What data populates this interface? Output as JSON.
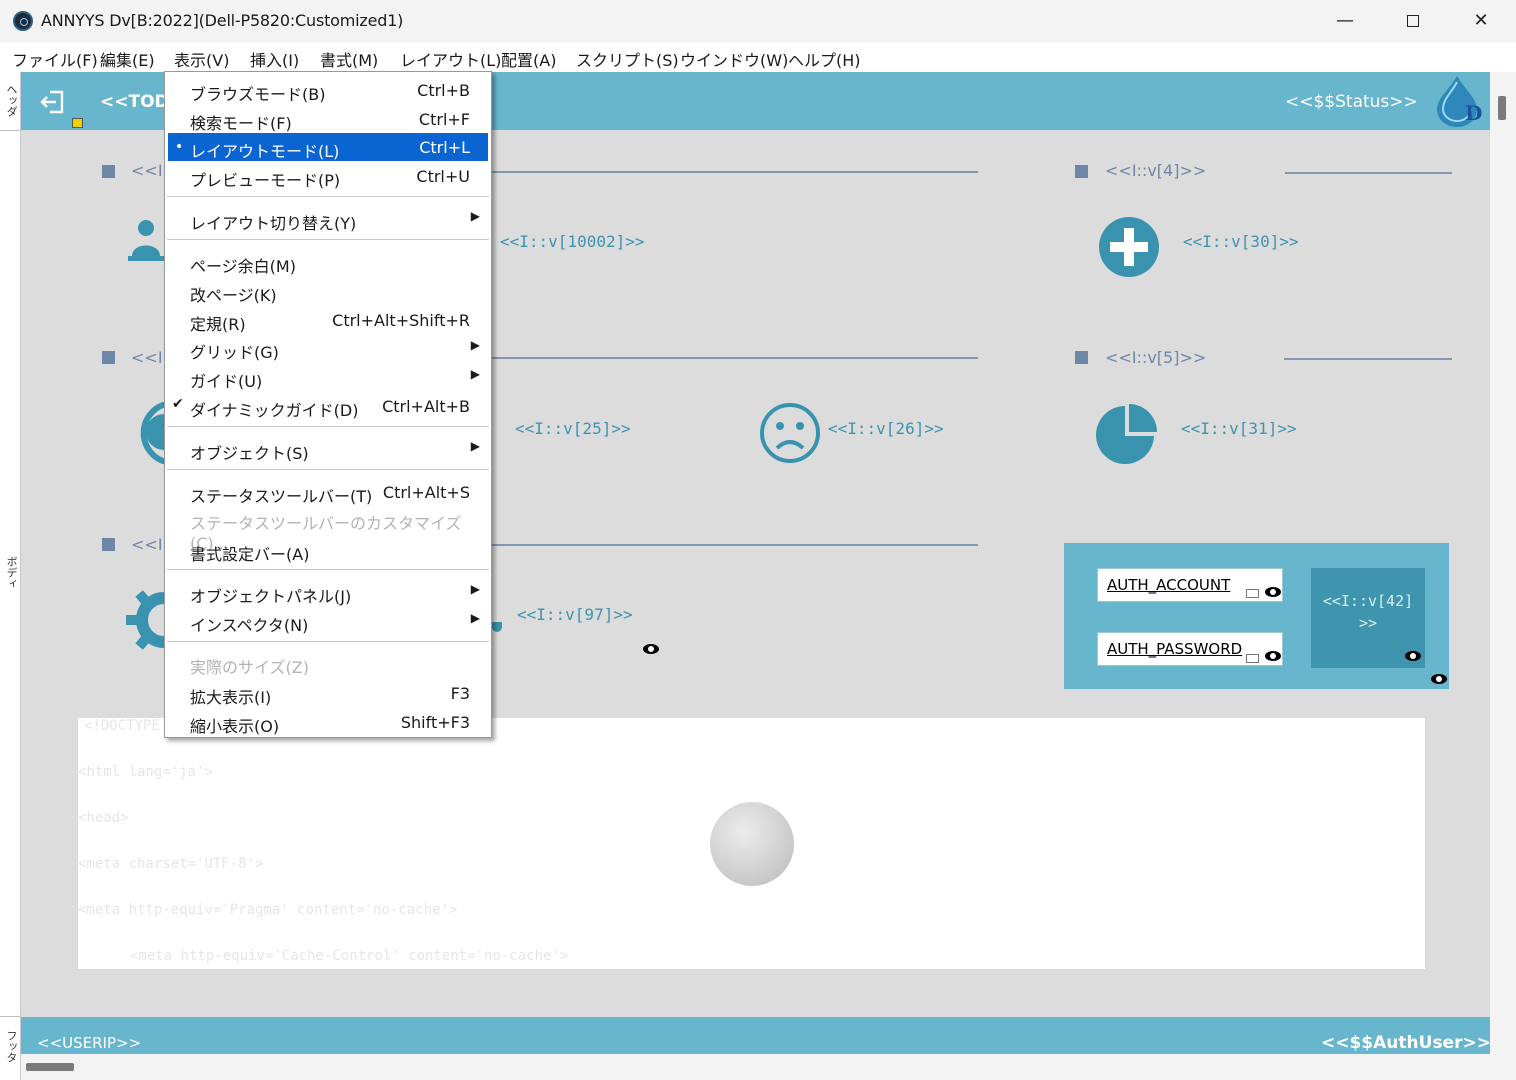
{
  "window": {
    "title": "ANNYYS Dv[B:2022](Dell-P5820:Customized1)"
  },
  "menubar": [
    {
      "label": "ファイル(F)"
    },
    {
      "label": "編集(E)"
    },
    {
      "label": "表示(V)"
    },
    {
      "label": "挿入(I)"
    },
    {
      "label": "書式(M)"
    },
    {
      "label": "レイアウト(L)"
    },
    {
      "label": "配置(A)"
    },
    {
      "label": "スクリプト(S)"
    },
    {
      "label": "ウインドウ(W)"
    },
    {
      "label": "ヘルプ(H)"
    }
  ],
  "ruler": {
    "header": "ヘッダ",
    "body": "ボディ",
    "footer": "フッタ"
  },
  "header": {
    "today": "<<TODA",
    "status": "<<$$Status>>"
  },
  "footer": {
    "userip": "<<USERIP>>",
    "authuser": "<<$$AuthUser>>"
  },
  "layout": {
    "row1_left": "<<I::",
    "row1_right": "<<I::v[4]>>",
    "row2_left": "<<I::",
    "row2_right": "<<I::v[5]>>",
    "row3_left": "<<I::",
    "v10002": "<<I::v[10002]>>",
    "v30": "<<I::v[30]>>",
    "v25": "<<I::v[25]>>",
    "v26": "<<I::v[26]>>",
    "v31": "<<I::v[31]>>",
    "v97": "<<I::v[97]>>",
    "auth_account": "AUTH_ACCOUNT",
    "auth_password": "AUTH_PASSWORD",
    "v42_line1": "<<I::v[42]",
    "v42_line2": ">>"
  },
  "code": [
    "<!DOCTYPE",
    "<html lang='ja'>",
    "<head>",
    "<meta charset='UTF-8'>",
    "<meta http-equiv='Pragma' content='no-cache'>",
    "<meta http-equiv='Cache-Control' content='no-cache'>"
  ],
  "view_menu": {
    "items": [
      {
        "label": "ブラウズモード(B)",
        "shortcut": "Ctrl+B"
      },
      {
        "label": "検索モード(F)",
        "shortcut": "Ctrl+F"
      },
      {
        "label": "レイアウトモード(L)",
        "shortcut": "Ctrl+L",
        "selected": true,
        "bullet": "•"
      },
      {
        "label": "プレビューモード(P)",
        "shortcut": "Ctrl+U"
      },
      {
        "label": "レイアウト切り替え(Y)",
        "submenu": true
      },
      {
        "label": "ページ余白(M)"
      },
      {
        "label": "改ページ(K)"
      },
      {
        "label": "定規(R)",
        "shortcut": "Ctrl+Alt+Shift+R"
      },
      {
        "label": "グリッド(G)",
        "submenu": true
      },
      {
        "label": "ガイド(U)",
        "submenu": true
      },
      {
        "label": "ダイナミックガイド(D)",
        "shortcut": "Ctrl+Alt+B",
        "checked": true
      },
      {
        "label": "オブジェクト(S)",
        "submenu": true
      },
      {
        "label": "ステータスツールバー(T)",
        "shortcut": "Ctrl+Alt+S"
      },
      {
        "label": "ステータスツールバーのカスタマイズ(C)...",
        "disabled": true
      },
      {
        "label": "書式設定バー(A)"
      },
      {
        "label": "オブジェクトパネル(J)",
        "submenu": true
      },
      {
        "label": "インスペクタ(N)",
        "submenu": true
      },
      {
        "label": "実際のサイズ(Z)",
        "disabled": true
      },
      {
        "label": "拡大表示(I)",
        "shortcut": "F3"
      },
      {
        "label": "縮小表示(O)",
        "shortcut": "Shift+F3"
      }
    ],
    "check_glyph": "✔",
    "submenu_glyph": "▶"
  },
  "colors": {
    "accent_band": "#67b6cd",
    "icon_teal": "#3a93ae",
    "menu_highlight": "#0a64d2"
  }
}
